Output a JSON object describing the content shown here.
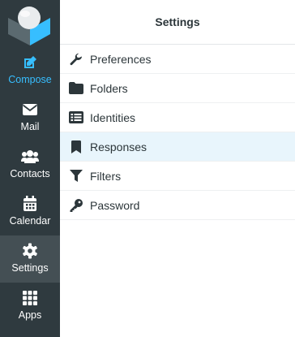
{
  "colors": {
    "sidebar_bg": "#2f3a3f",
    "sidebar_selected_bg": "#444f54",
    "accent": "#37beff",
    "list_selected_bg": "#e8f5fc",
    "text": "#2c363a"
  },
  "sidebar": {
    "logo_icon": "roundcube-logo-icon",
    "items": [
      {
        "label": "Compose",
        "icon": "compose-icon",
        "active": false,
        "accent": true
      },
      {
        "label": "Mail",
        "icon": "envelope-icon",
        "active": false
      },
      {
        "label": "Contacts",
        "icon": "users-icon",
        "active": false
      },
      {
        "label": "Calendar",
        "icon": "calendar-icon",
        "active": false
      },
      {
        "label": "Settings",
        "icon": "gear-icon",
        "active": true
      },
      {
        "label": "Apps",
        "icon": "grid-icon",
        "active": false
      }
    ]
  },
  "main": {
    "title": "Settings",
    "items": [
      {
        "label": "Preferences",
        "icon": "wrench-icon",
        "selected": false
      },
      {
        "label": "Folders",
        "icon": "folder-icon",
        "selected": false
      },
      {
        "label": "Identities",
        "icon": "id-list-icon",
        "selected": false
      },
      {
        "label": "Responses",
        "icon": "bookmark-icon",
        "selected": true
      },
      {
        "label": "Filters",
        "icon": "filter-icon",
        "selected": false
      },
      {
        "label": "Password",
        "icon": "key-icon",
        "selected": false
      }
    ]
  }
}
